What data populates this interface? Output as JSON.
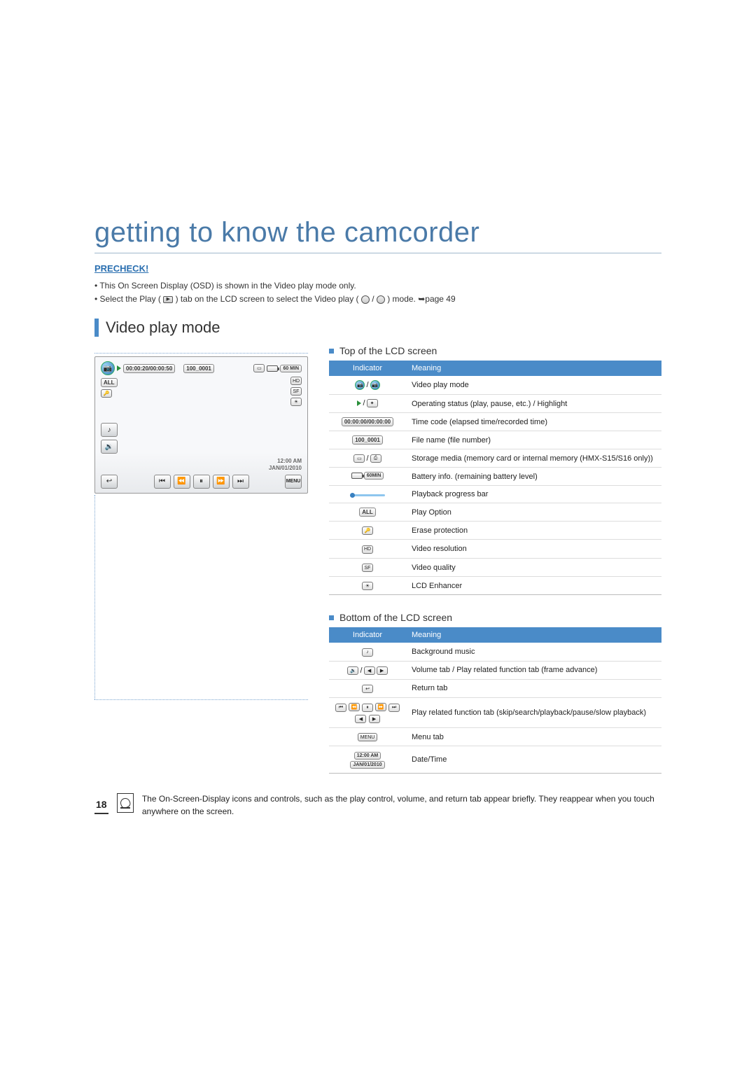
{
  "chapter_title": "getting to know the camcorder",
  "precheck_label": "PRECHECK!",
  "bullets": [
    "This On Screen Display (OSD) is shown in the Video play mode only.",
    "Select the Play ( ▢ ) tab on the LCD screen to select the Video play ( 🎥 / 🎥 ) mode. ➥page 49"
  ],
  "section_title": "Video play mode",
  "top_subhead": "Top of the LCD screen",
  "bottom_subhead": "Bottom of the LCD screen",
  "table_headers": {
    "indicator": "Indicator",
    "meaning": "Meaning"
  },
  "top_table": [
    {
      "icon": "video-play-mode-icon",
      "meaning": "Video play mode"
    },
    {
      "icon": "play-highlight-icon",
      "meaning": "Operating status (play, pause, etc.) / Highlight"
    },
    {
      "icon": "time-code-label",
      "label": "00:00:00/00:00:00",
      "meaning": "Time code (elapsed time/recorded time)"
    },
    {
      "icon": "file-name-label",
      "label": "100_0001",
      "meaning": "File name (file number)"
    },
    {
      "icon": "storage-media-icon",
      "meaning": "Storage media (memory card or internal memory (HMX-S15/S16 only))"
    },
    {
      "icon": "battery-info-icon",
      "label": "60MIN",
      "meaning": "Battery info. (remaining battery level)"
    },
    {
      "icon": "progress-bar-icon",
      "meaning": "Playback progress bar"
    },
    {
      "icon": "play-option-icon",
      "label": "ALL",
      "meaning": "Play Option"
    },
    {
      "icon": "erase-protection-icon",
      "meaning": "Erase protection"
    },
    {
      "icon": "video-resolution-icon",
      "label": "HD",
      "meaning": "Video resolution"
    },
    {
      "icon": "video-quality-icon",
      "label": "SF",
      "meaning": "Video quality"
    },
    {
      "icon": "lcd-enhancer-icon",
      "meaning": "LCD Enhancer"
    }
  ],
  "bottom_table": [
    {
      "icon": "bg-music-icon",
      "meaning": "Background music"
    },
    {
      "icon": "volume-frame-icon",
      "meaning": "Volume tab / Play related function tab (frame advance)"
    },
    {
      "icon": "return-tab-icon",
      "meaning": "Return tab"
    },
    {
      "icon": "play-controls-icon",
      "meaning": "Play related function tab (skip/search/playback/pause/slow playback)"
    },
    {
      "icon": "menu-tab-icon",
      "label": "MENU",
      "meaning": "Menu tab"
    },
    {
      "icon": "datetime-icon",
      "labels": [
        "12:00 AM",
        "JAN/01/2010"
      ],
      "meaning": "Date/Time"
    }
  ],
  "osd": {
    "time_code": "00:00:20/00:00:50",
    "file_name": "100_0001",
    "battery": "60 MIN",
    "resolution": "HD",
    "quality": "SF",
    "play_option": "ALL",
    "time": "12:00 AM",
    "date": "JAN/01/2010",
    "menu_label": "MENU"
  },
  "page_number": "18",
  "note_text": "The On-Screen-Display icons and controls, such as the play control, volume, and return tab appear briefly. They reappear when you touch anywhere on the screen."
}
